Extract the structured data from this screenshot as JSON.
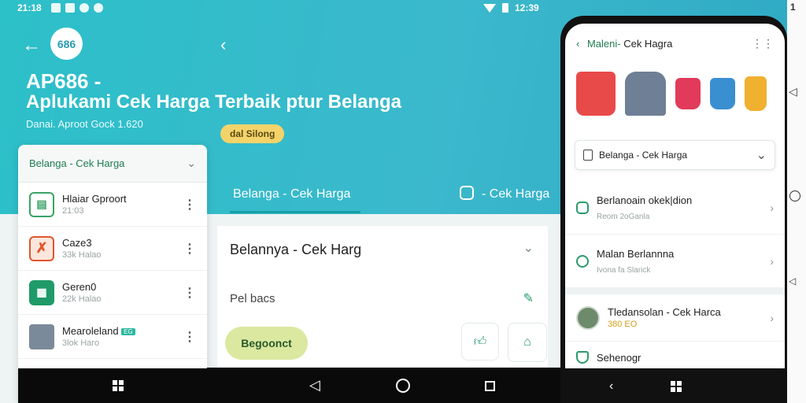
{
  "status": {
    "time": "21:18",
    "right_time": "12:39",
    "phone_status": "1"
  },
  "app": {
    "logo_text": "686",
    "title": "AP686 -",
    "subtitle": "Aplukami Cek Harga Terbaik ptur Belanga",
    "meta": "Danai. Aproot  Gock 1.620",
    "badge": "dal Silong"
  },
  "tabs": {
    "tab1": "Belanga - Cek Harga",
    "tab2": "- Cek Harga"
  },
  "left_card": {
    "header": "Belanga - Cek Harga",
    "items": [
      {
        "title": "Hlaiar Gproort",
        "sub": "21:03",
        "icon_color": "#3aa366"
      },
      {
        "title": "Caze3",
        "sub": "33k Halao",
        "icon_color": "#e2552c"
      },
      {
        "title": "Geren0",
        "sub": "22k Halao",
        "icon_color": "#1f9a68"
      },
      {
        "title": "Mearoleland",
        "sub": "3lok Haro",
        "badge": "EG",
        "icon_color": "#7b8a9a"
      }
    ]
  },
  "center_panel": {
    "title": "Belannya - Cek Harg",
    "subtitle": "Pel bacs",
    "primary_button": "Begoonct"
  },
  "phone": {
    "header_brand": "Maleni-",
    "header_rest": " Cek Hagra",
    "select_label": "Belanga - Cek Harga",
    "list": [
      {
        "title": "Berlanoain okek|dion",
        "sub": "Reom 2oGanla"
      },
      {
        "title": "Malan Berlannna",
        "sub": "Ivona fa Slarick"
      }
    ],
    "profile": {
      "title": "Tledansolan - Cek Harca",
      "meta": "380 EO"
    },
    "last_item": "Sehenogr"
  },
  "colors": {
    "accent": "#2cc0c9",
    "green": "#1f7d50",
    "badge": "#f3d36a"
  }
}
